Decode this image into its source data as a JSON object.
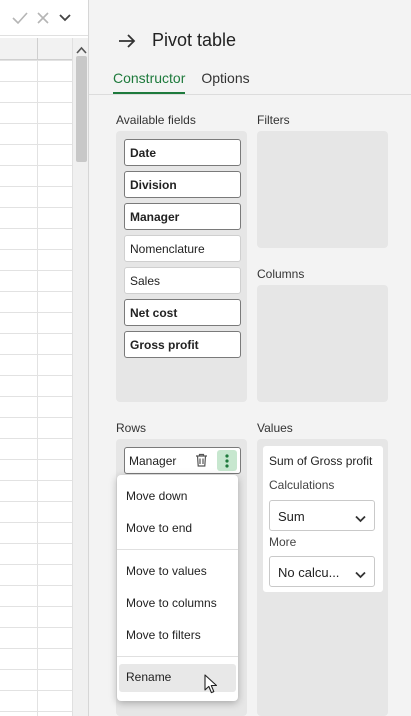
{
  "formula_bar": {
    "accept_icon": "check-icon",
    "cancel_icon": "close-icon",
    "expand_icon": "chevron-down-icon"
  },
  "panel": {
    "title": "Pivot table",
    "tabs": [
      {
        "label": "Constructor",
        "active": true
      },
      {
        "label": "Options",
        "active": false
      }
    ]
  },
  "sections": {
    "available_fields": "Available fields",
    "filters": "Filters",
    "columns": "Columns",
    "rows": "Rows",
    "values": "Values"
  },
  "fields": [
    {
      "label": "Date",
      "used": true
    },
    {
      "label": "Division",
      "used": true
    },
    {
      "label": "Manager",
      "used": true
    },
    {
      "label": "Nomenclature",
      "used": false
    },
    {
      "label": "Sales",
      "used": false
    },
    {
      "label": "Net cost",
      "used": true
    },
    {
      "label": "Gross profit",
      "used": true
    }
  ],
  "rows_zone": {
    "item_label": "Manager"
  },
  "values_zone": {
    "card_title": "Sum of Gross profit",
    "calculations_label": "Calculations",
    "calculations_value": "Sum",
    "more_label": "More",
    "more_value": "No calcu..."
  },
  "context_menu": {
    "items": [
      {
        "label": "Move down"
      },
      {
        "label": "Move to end"
      },
      {
        "label": "Move to values"
      },
      {
        "label": "Move to columns"
      },
      {
        "label": "Move to filters"
      },
      {
        "label": "Rename",
        "hovered": true
      }
    ]
  },
  "colors": {
    "accent": "#1e7a3c",
    "menu_button_bg": "#c7e7cf"
  }
}
